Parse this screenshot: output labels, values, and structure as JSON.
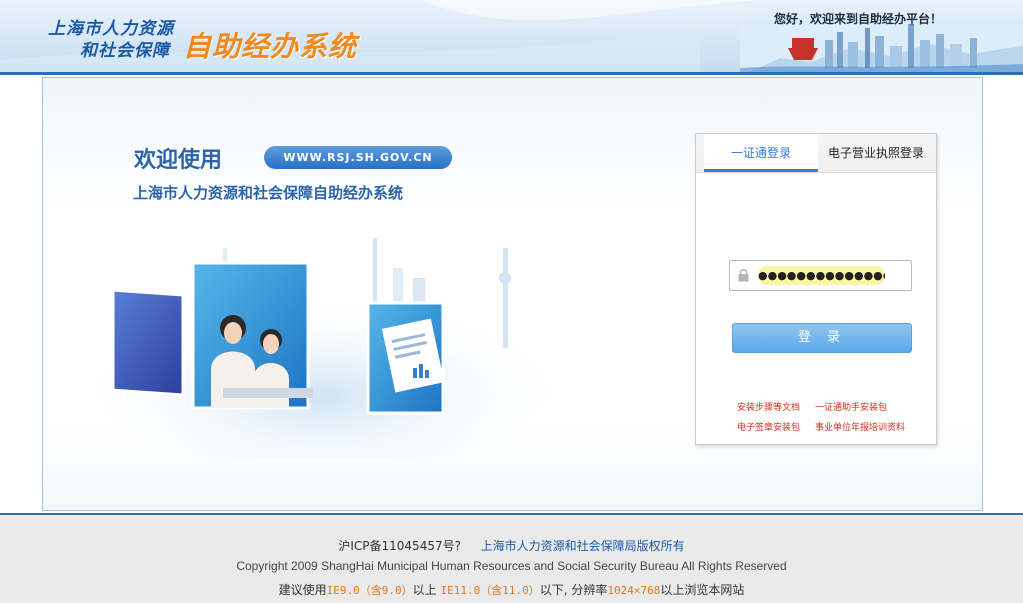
{
  "header": {
    "logo_line1": "上海市人力资源",
    "logo_line2": "和社会保障",
    "logo_big": "自助经办系统",
    "greeting": "您好，欢迎来到自助经办平台！"
  },
  "hero": {
    "welcome": "欢迎使用",
    "url": "WWW.RSJ.SH.GOV.CN",
    "system_title": "上海市人力资源和社会保障自助经办系统"
  },
  "login": {
    "tabs": [
      {
        "label": "一证通登录",
        "active": true
      },
      {
        "label": "电子营业执照登录",
        "active": false
      }
    ],
    "password_value": "●●●●●●●●●●●●●●●",
    "button_label": "登 录",
    "links": [
      "安装步骤等文档",
      "一证通助手安装包",
      "电子签章安装包",
      "事业单位年报培训资料"
    ]
  },
  "footer": {
    "icp": "沪ICP备11045457号?",
    "owner": "上海市人力资源和社会保障局版权所有",
    "copyright": "Copyright 2009 ShangHai Municipal Human Resources and Social Security Bureau All Rights Reserved",
    "suggest_prefix": "建议使用",
    "ie9": "IE9.0（含9.0）",
    "above": "以上 ",
    "ie11": "IE11.0（含11.0）",
    "below": "以下, 分辨率",
    "resolution": "1024×768",
    "suffix": "以上浏览本网站"
  },
  "colors": {
    "brand_blue": "#2a6fb8",
    "accent_orange": "#f08a1e",
    "link_red": "#d0311f"
  }
}
